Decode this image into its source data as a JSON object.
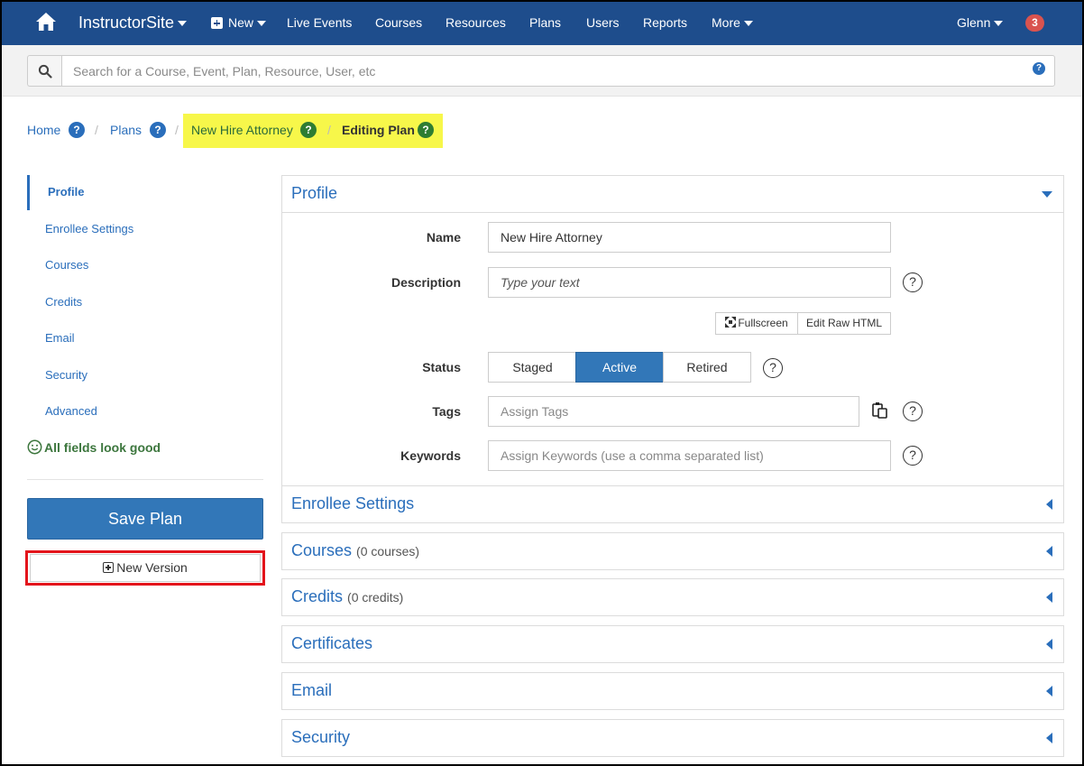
{
  "nav": {
    "brand": "InstructorSite",
    "new_label": "New",
    "items": [
      "Live Events",
      "Courses",
      "Resources",
      "Plans",
      "Users",
      "Reports"
    ],
    "more_label": "More",
    "user": "Glenn",
    "notifications": "3"
  },
  "search": {
    "placeholder": "Search for a Course, Event, Plan, Resource, User, etc",
    "help": "?"
  },
  "breadcrumb": {
    "home": "Home",
    "plans": "Plans",
    "plan_name": "New Hire Attorney",
    "current": "Editing Plan",
    "separator": "/",
    "help": "?"
  },
  "sidebar": {
    "items": [
      "Profile",
      "Enrollee Settings",
      "Courses",
      "Credits",
      "Email",
      "Security",
      "Advanced"
    ],
    "status": "All fields look good",
    "save_label": "Save Plan",
    "new_version_label": "New Version"
  },
  "profile": {
    "title": "Profile",
    "name_label": "Name",
    "name_value": "New Hire Attorney",
    "description_label": "Description",
    "description_placeholder": "Type your text",
    "fullscreen_label": "Fullscreen",
    "edit_raw_label": "Edit Raw HTML",
    "status_label": "Status",
    "status_options": [
      "Staged",
      "Active",
      "Retired"
    ],
    "status_selected": "Active",
    "tags_label": "Tags",
    "tags_placeholder": "Assign Tags",
    "keywords_label": "Keywords",
    "keywords_placeholder": "Assign Keywords (use a comma separated list)",
    "help": "?"
  },
  "panels": [
    {
      "title": "Enrollee Settings",
      "count": ""
    },
    {
      "title": "Courses",
      "count": "(0 courses)"
    },
    {
      "title": "Credits",
      "count": "(0 credits)"
    },
    {
      "title": "Certificates",
      "count": ""
    },
    {
      "title": "Email",
      "count": ""
    },
    {
      "title": "Security",
      "count": ""
    }
  ],
  "colors": {
    "nav_bg": "#1e4d8c",
    "accent": "#2a6ebb",
    "primary_button": "#3277b8",
    "success": "#3c763d",
    "highlight": "#f7f74a",
    "annotation_red": "#e3141b",
    "badge_red": "#d9534f"
  },
  "icons": [
    "home-icon",
    "plus-square-icon",
    "caret-down-icon",
    "search-icon",
    "help-icon",
    "smile-icon",
    "expand-icon",
    "clipboard-icon",
    "chevron-left-icon",
    "chevron-down-icon"
  ]
}
